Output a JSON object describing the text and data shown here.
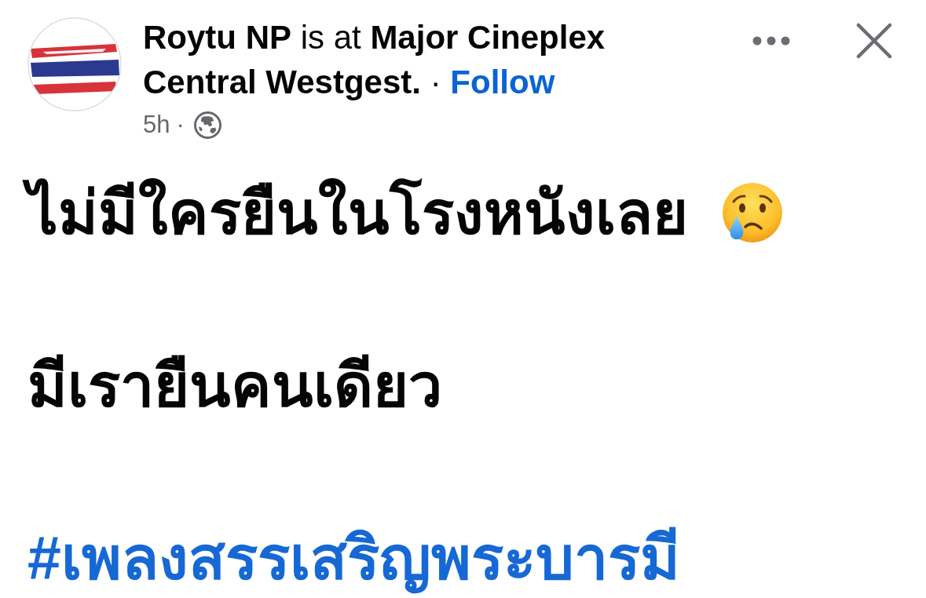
{
  "post_header": {
    "title": "**Roytu NP** is at **Major Cineplex Central Westgest.**",
    "separator": "·",
    "follow_link": "Follow",
    "time": "5h",
    "time_separator": "·"
  },
  "post_body": [
    {
      "kind": "text",
      "text": "ไม่มีใครยืนในโรงหนังเลย",
      "trailing_emoji": true
    },
    {
      "kind": "text",
      "text": "มีเรายืนคนเดียว",
      "trailing_emoji": false
    },
    {
      "kind": "hashtag",
      "text": "#เพลงสรรเสริญพระบารมี",
      "trailing_emoji": false
    }
  ]
}
